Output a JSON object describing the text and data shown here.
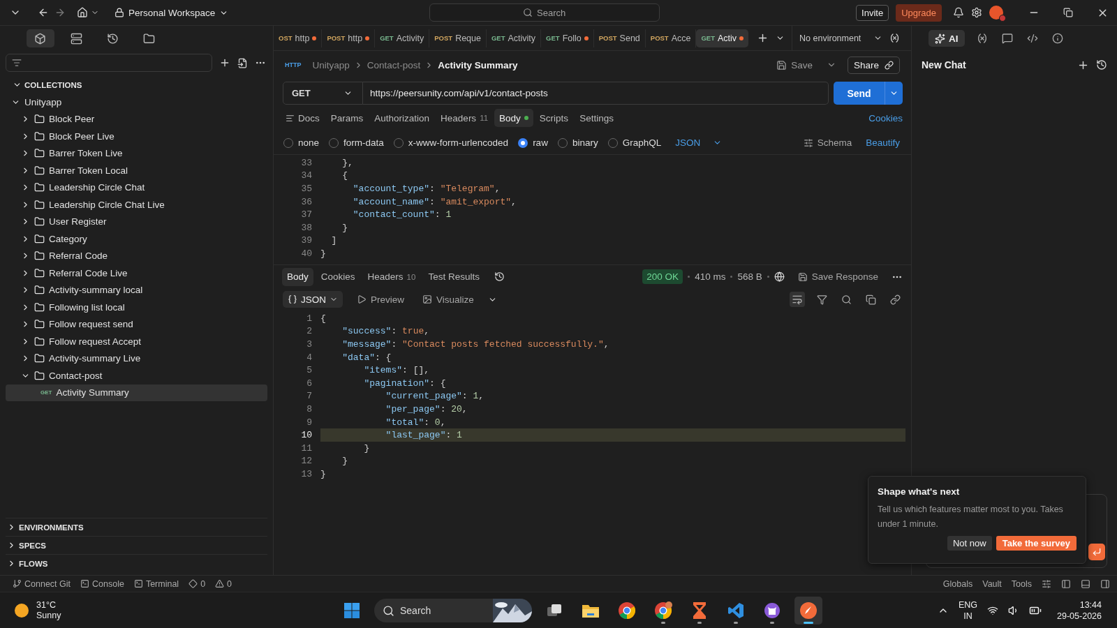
{
  "titlebar": {
    "workspace": "Personal Workspace",
    "search": {
      "placeholder": "Search"
    },
    "invite": "Invite",
    "upgrade": "Upgrade"
  },
  "sidebar": {
    "views": [
      {
        "kind": "collections",
        "selected": true
      },
      {
        "kind": "environments",
        "selected": false
      },
      {
        "kind": "history",
        "selected": false
      },
      {
        "kind": "files",
        "selected": false
      }
    ],
    "sections": [
      {
        "label": "COLLECTIONS",
        "expanded": true,
        "items": [
          {
            "kind": "collection",
            "label": "Unityapp",
            "expanded": true,
            "selected": false,
            "children": [
              {
                "kind": "folder",
                "label": "Block Peer",
                "expanded": false,
                "selected": false
              },
              {
                "kind": "folder",
                "label": "Block Peer Live",
                "expanded": false,
                "selected": false
              },
              {
                "kind": "folder",
                "label": "Barrer Token Live",
                "expanded": false,
                "selected": false
              },
              {
                "kind": "folder",
                "label": "Barrer Token Local",
                "expanded": false,
                "selected": false
              },
              {
                "kind": "folder",
                "label": "Leadership Circle Chat",
                "expanded": false,
                "selected": false
              },
              {
                "kind": "folder",
                "label": "Leadership Circle Chat Live",
                "expanded": false,
                "selected": false
              },
              {
                "kind": "folder",
                "label": "User Register",
                "expanded": false,
                "selected": false
              },
              {
                "kind": "folder",
                "label": "Category",
                "expanded": false,
                "selected": false
              },
              {
                "kind": "folder",
                "label": "Referral Code",
                "expanded": false,
                "selected": false
              },
              {
                "kind": "folder",
                "label": "Referral Code Live",
                "expanded": false,
                "selected": false
              },
              {
                "kind": "folder",
                "label": "Activity-summary local",
                "expanded": false,
                "selected": false
              },
              {
                "kind": "folder",
                "label": "Following list local",
                "expanded": false,
                "selected": false
              },
              {
                "kind": "folder",
                "label": "Follow request send",
                "expanded": false,
                "selected": false
              },
              {
                "kind": "folder",
                "label": "Follow request Accept",
                "expanded": false,
                "selected": false
              },
              {
                "kind": "folder",
                "label": "Activity-summary Live",
                "expanded": false,
                "selected": false
              },
              {
                "kind": "folder",
                "label": "Contact-post",
                "expanded": true,
                "selected": false,
                "children": [
                  {
                    "kind": "request",
                    "method": "GET",
                    "label": "Activity Summary",
                    "selected": true
                  }
                ]
              }
            ]
          }
        ]
      },
      {
        "label": "ENVIRONMENTS",
        "expanded": false
      },
      {
        "label": "SPECS",
        "expanded": false
      },
      {
        "label": "FLOWS",
        "expanded": false
      }
    ]
  },
  "tabs": [
    {
      "kind": "post",
      "method": "OST",
      "name": "http",
      "unsaved": true,
      "selected": false
    },
    {
      "kind": "post",
      "method": "POST",
      "name": "http",
      "unsaved": true,
      "selected": false
    },
    {
      "kind": "get",
      "method": "GET",
      "name": "Activity",
      "unsaved": false,
      "selected": false
    },
    {
      "kind": "post",
      "method": "POST",
      "name": "Reque",
      "unsaved": false,
      "selected": false
    },
    {
      "kind": "get",
      "method": "GET",
      "name": "Activity",
      "unsaved": false,
      "selected": false
    },
    {
      "kind": "get",
      "method": "GET",
      "name": "Follo",
      "unsaved": true,
      "selected": false
    },
    {
      "kind": "post",
      "method": "POST",
      "name": "Send",
      "unsaved": false,
      "selected": false
    },
    {
      "kind": "post",
      "method": "POST",
      "name": "Acce",
      "unsaved": false,
      "selected": false
    },
    {
      "kind": "get",
      "method": "GET",
      "name": "Activ",
      "unsaved": true,
      "selected": true
    }
  ],
  "environment": "No environment",
  "request": {
    "protocol": "HTTP",
    "breadcrumb": [
      "Unityapp",
      "Contact-post"
    ],
    "title": "Activity Summary",
    "save": "Save",
    "share": "Share",
    "method": "GET",
    "url": "https://peersunity.com/api/v1/contact-posts",
    "send": "Send",
    "tabs": [
      {
        "label": "Docs",
        "selected": false
      },
      {
        "label": "Params",
        "selected": false
      },
      {
        "label": "Authorization",
        "selected": false
      },
      {
        "label": "Headers",
        "count": "11",
        "selected": false
      },
      {
        "label": "Body",
        "dot": true,
        "selected": true
      },
      {
        "label": "Scripts",
        "selected": false
      },
      {
        "label": "Settings",
        "selected": false
      }
    ],
    "cookies": "Cookies",
    "body_types": [
      {
        "label": "none",
        "selected": false
      },
      {
        "label": "form-data",
        "selected": false
      },
      {
        "label": "x-www-form-urlencoded",
        "selected": false
      },
      {
        "label": "raw",
        "selected": true
      },
      {
        "label": "binary",
        "selected": false
      },
      {
        "label": "GraphQL",
        "selected": false
      }
    ],
    "format": "JSON",
    "schema": "Schema",
    "beautify": "Beautify",
    "lines": [
      {
        "number": "33",
        "tokens": [
          {
            "kind": "p",
            "text": "    },"
          }
        ]
      },
      {
        "number": "34",
        "tokens": [
          {
            "kind": "p",
            "text": "    {"
          }
        ]
      },
      {
        "number": "35",
        "tokens": [
          {
            "kind": "k",
            "text": "      \"account_type\""
          },
          {
            "kind": "p",
            "text": ": "
          },
          {
            "kind": "s",
            "text": "\"Telegram\""
          },
          {
            "kind": "p",
            "text": ","
          }
        ]
      },
      {
        "number": "36",
        "tokens": [
          {
            "kind": "k",
            "text": "      \"account_name\""
          },
          {
            "kind": "p",
            "text": ": "
          },
          {
            "kind": "s",
            "text": "\"amit_export\""
          },
          {
            "kind": "p",
            "text": ","
          }
        ]
      },
      {
        "number": "37",
        "tokens": [
          {
            "kind": "k",
            "text": "      \"contact_count\""
          },
          {
            "kind": "p",
            "text": ": "
          },
          {
            "kind": "n",
            "text": "1"
          }
        ]
      },
      {
        "number": "38",
        "tokens": [
          {
            "kind": "p",
            "text": "    }"
          }
        ]
      },
      {
        "number": "39",
        "tokens": [
          {
            "kind": "p",
            "text": "  ]"
          }
        ]
      },
      {
        "number": "40",
        "tokens": [
          {
            "kind": "p",
            "text": "}"
          }
        ]
      }
    ]
  },
  "response": {
    "tabs": [
      {
        "label": "Body",
        "selected": true
      },
      {
        "label": "Cookies",
        "selected": false
      },
      {
        "label": "Headers",
        "count": "10",
        "selected": false
      },
      {
        "label": "Test Results",
        "selected": false
      }
    ],
    "status": "200 OK",
    "time": "410 ms",
    "size": "568 B",
    "save_response": "Save Response",
    "format": "JSON",
    "preview": "Preview",
    "visualize": "Visualize",
    "lines": [
      {
        "number": "1",
        "current": false,
        "tokens": [
          {
            "kind": "p",
            "text": "{"
          }
        ]
      },
      {
        "number": "2",
        "current": false,
        "tokens": [
          {
            "kind": "k",
            "text": "    \"success\""
          },
          {
            "kind": "p",
            "text": ": "
          },
          {
            "kind": "b",
            "text": "true"
          },
          {
            "kind": "p",
            "text": ","
          }
        ]
      },
      {
        "number": "3",
        "current": false,
        "tokens": [
          {
            "kind": "k",
            "text": "    \"message\""
          },
          {
            "kind": "p",
            "text": ": "
          },
          {
            "kind": "s",
            "text": "\"Contact posts fetched successfully.\""
          },
          {
            "kind": "p",
            "text": ","
          }
        ]
      },
      {
        "number": "4",
        "current": false,
        "tokens": [
          {
            "kind": "k",
            "text": "    \"data\""
          },
          {
            "kind": "p",
            "text": ": {"
          }
        ]
      },
      {
        "number": "5",
        "current": false,
        "tokens": [
          {
            "kind": "k",
            "text": "        \"items\""
          },
          {
            "kind": "p",
            "text": ": [],"
          }
        ]
      },
      {
        "number": "6",
        "current": false,
        "tokens": [
          {
            "kind": "k",
            "text": "        \"pagination\""
          },
          {
            "kind": "p",
            "text": ": {"
          }
        ]
      },
      {
        "number": "7",
        "current": false,
        "tokens": [
          {
            "kind": "k",
            "text": "            \"current_page\""
          },
          {
            "kind": "p",
            "text": ": "
          },
          {
            "kind": "n",
            "text": "1"
          },
          {
            "kind": "p",
            "text": ","
          }
        ]
      },
      {
        "number": "8",
        "current": false,
        "tokens": [
          {
            "kind": "k",
            "text": "            \"per_page\""
          },
          {
            "kind": "p",
            "text": ": "
          },
          {
            "kind": "n",
            "text": "20"
          },
          {
            "kind": "p",
            "text": ","
          }
        ]
      },
      {
        "number": "9",
        "current": false,
        "tokens": [
          {
            "kind": "k",
            "text": "            \"total\""
          },
          {
            "kind": "p",
            "text": ": "
          },
          {
            "kind": "n",
            "text": "0"
          },
          {
            "kind": "p",
            "text": ","
          }
        ]
      },
      {
        "number": "10",
        "current": true,
        "tokens": [
          {
            "kind": "k",
            "text": "            \"last_page\""
          },
          {
            "kind": "p",
            "text": ": "
          },
          {
            "kind": "n",
            "text": "1"
          }
        ]
      },
      {
        "number": "11",
        "current": false,
        "tokens": [
          {
            "kind": "p",
            "text": "        }"
          }
        ]
      },
      {
        "number": "12",
        "current": false,
        "tokens": [
          {
            "kind": "p",
            "text": "    }"
          }
        ]
      },
      {
        "number": "13",
        "current": false,
        "tokens": [
          {
            "kind": "p",
            "text": "}"
          }
        ]
      }
    ]
  },
  "ai_panel": {
    "tools": [
      {
        "kind": "ai",
        "label": "AI",
        "selected": true
      },
      {
        "kind": "variables",
        "selected": false
      },
      {
        "kind": "comments",
        "selected": false
      },
      {
        "kind": "code",
        "selected": false
      },
      {
        "kind": "info",
        "selected": false
      }
    ],
    "title": "New Chat"
  },
  "survey": {
    "title": "Shape what's next",
    "text": "Tell us which features matter most to you. Takes under 1 minute.",
    "dismiss": "Not now",
    "accept": "Take the survey"
  },
  "status_bar": {
    "left": [
      {
        "kind": "git",
        "label": "Connect Git"
      },
      {
        "kind": "console",
        "label": "Console"
      },
      {
        "kind": "terminal",
        "label": "Terminal"
      },
      {
        "kind": "errors",
        "label": "0"
      },
      {
        "kind": "warnings",
        "label": "0"
      }
    ],
    "right": [
      "Globals",
      "Vault",
      "Tools"
    ]
  },
  "taskbar": {
    "temperature": "31°C",
    "weather": "Sunny",
    "search": {
      "placeholder": "Search"
    },
    "apps": [
      {
        "kind": "start",
        "running": false,
        "selected": false
      },
      {
        "kind": "task-view",
        "running": false,
        "selected": false
      },
      {
        "kind": "files",
        "running": false,
        "selected": false
      },
      {
        "kind": "browser",
        "running": false,
        "selected": false
      },
      {
        "kind": "browser-profile",
        "running": true,
        "selected": false
      },
      {
        "kind": "hourglass",
        "running": true,
        "selected": false
      },
      {
        "kind": "editor",
        "running": true,
        "selected": false
      },
      {
        "kind": "cat",
        "running": true,
        "selected": false
      },
      {
        "kind": "rocket",
        "running": true,
        "selected": true
      }
    ],
    "language": "ENG",
    "region": "IN",
    "time": "13:44",
    "date": "29-05-2026"
  }
}
